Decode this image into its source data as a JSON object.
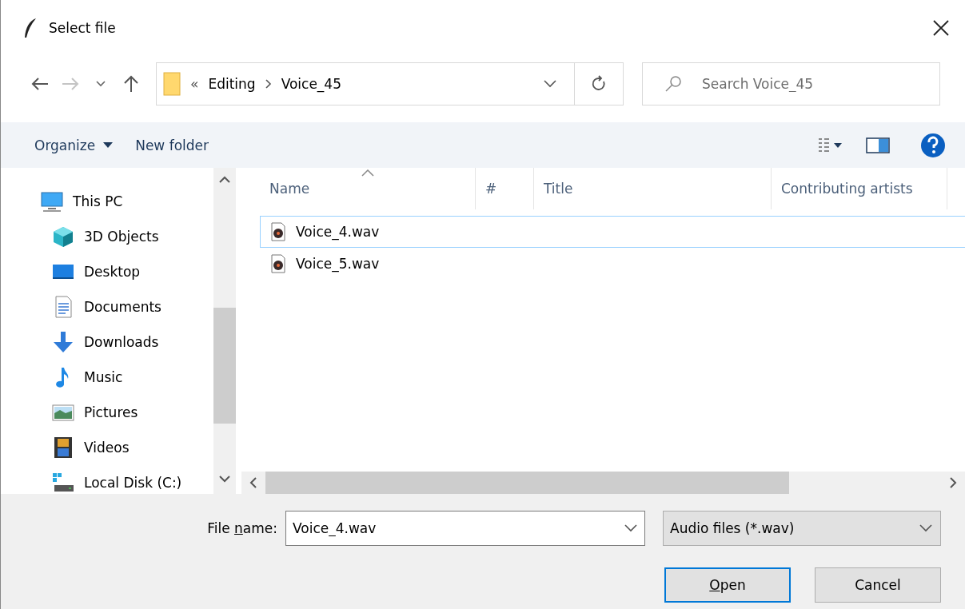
{
  "window": {
    "title": "Select file"
  },
  "address": {
    "overflow": "«",
    "crumbs": [
      "Editing",
      "Voice_45"
    ]
  },
  "search": {
    "placeholder": "Search Voice_45"
  },
  "toolbar": {
    "organize": "Organize",
    "new_folder": "New folder"
  },
  "sidebar": {
    "items": [
      {
        "label": "This PC",
        "children": [
          {
            "label": "3D Objects"
          },
          {
            "label": "Desktop"
          },
          {
            "label": "Documents"
          },
          {
            "label": "Downloads"
          },
          {
            "label": "Music"
          },
          {
            "label": "Pictures"
          },
          {
            "label": "Videos"
          },
          {
            "label": "Local Disk (C:)"
          }
        ]
      }
    ]
  },
  "table": {
    "columns": [
      "Name",
      "#",
      "Title",
      "Contributing artists"
    ],
    "rows": [
      {
        "name": "Voice_4.wav",
        "selected": true
      },
      {
        "name": "Voice_5.wav",
        "selected": false
      }
    ]
  },
  "file_name": {
    "label": {
      "before": "File ",
      "key": "n",
      "after": "ame:"
    },
    "value": "Voice_4.wav"
  },
  "file_type": {
    "value": "Audio files (*.wav)"
  },
  "buttons": [
    {
      "key": "O",
      "after": "pen",
      "default": true
    },
    {
      "before": "Cancel",
      "default": false
    }
  ]
}
